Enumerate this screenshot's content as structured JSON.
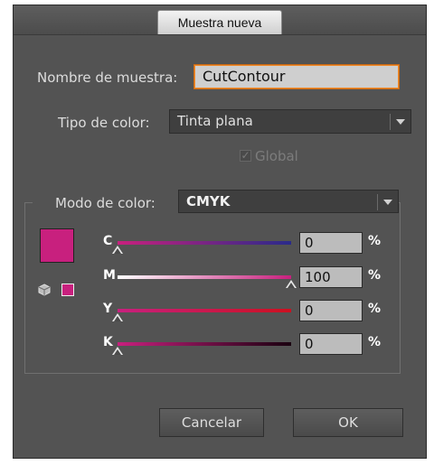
{
  "dialog": {
    "title": "Muestra nueva",
    "name_label": "Nombre de muestra:",
    "name_value": "CutContour",
    "color_type_label": "Tipo de color:",
    "color_type_value": "Tinta plana",
    "global_label": "Global",
    "global_checked": true,
    "global_enabled": false,
    "color_mode_label": "Modo de color:",
    "color_mode_value": "CMYK",
    "swatch_color": "#c8207e",
    "channels": [
      {
        "label": "C",
        "value": "0",
        "unit": "%",
        "level": 0,
        "gradient": [
          "#c8207e",
          "#2a2a8a"
        ]
      },
      {
        "label": "M",
        "value": "100",
        "unit": "%",
        "level": 100,
        "gradient": [
          "#ffffff",
          "#c8207e"
        ]
      },
      {
        "label": "Y",
        "value": "0",
        "unit": "%",
        "level": 0,
        "gradient": [
          "#c8207e",
          "#cc1020"
        ]
      },
      {
        "label": "K",
        "value": "0",
        "unit": "%",
        "level": 0,
        "gradient": [
          "#c8207e",
          "#1a0010"
        ]
      }
    ],
    "cancel_label": "Cancelar",
    "ok_label": "OK"
  }
}
